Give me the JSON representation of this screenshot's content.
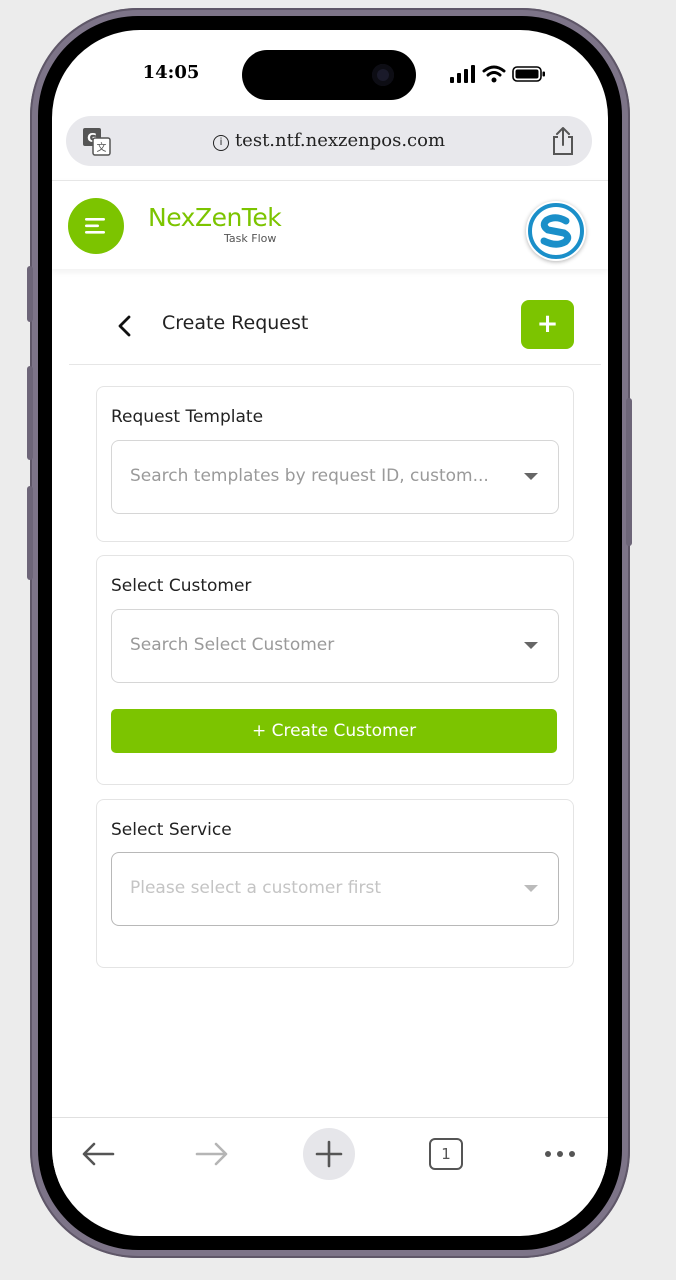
{
  "status_bar": {
    "time": "14:05"
  },
  "browser": {
    "url": "test.ntf.nexzenpos.com",
    "tab_count": "1"
  },
  "app": {
    "logo_main": "NexZenTek",
    "logo_sub": "Task Flow",
    "avatar_letter": "S"
  },
  "page": {
    "title": "Create Request",
    "add_label": "+"
  },
  "request_template": {
    "label": "Request Template",
    "placeholder": "Search templates by request ID, custom..."
  },
  "customer": {
    "label": "Select Customer",
    "placeholder": "Search Select Customer",
    "create_button": "+ Create Customer"
  },
  "service": {
    "label": "Select Service",
    "placeholder": "Please select a customer first"
  },
  "colors": {
    "accent": "#7cc400",
    "avatar_blue": "#1a8fc9"
  }
}
